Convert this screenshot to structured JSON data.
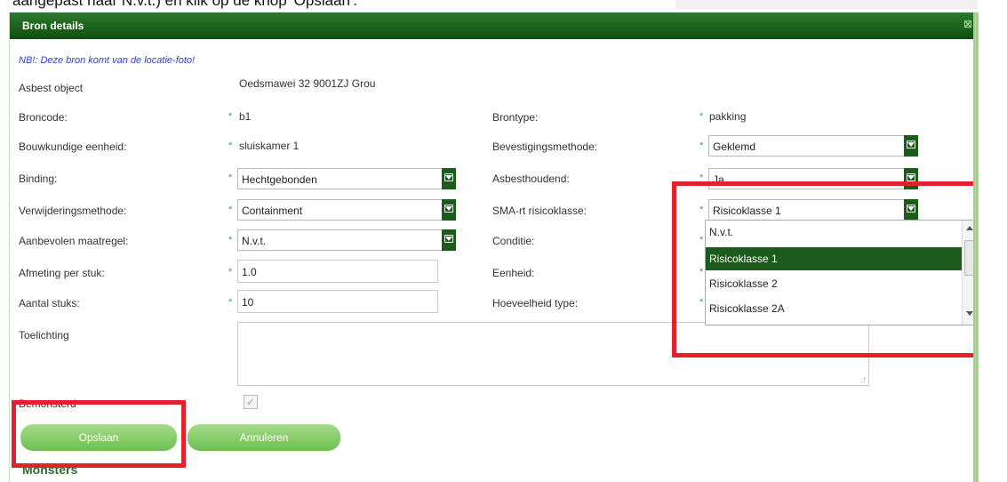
{
  "doc_caption": "aangepast naar N.v.t.) en klik op de knop 'Opslaan'.",
  "dialog": {
    "title": "Bron details",
    "note": "NB!: Deze bron komt van de locatie-foto!"
  },
  "fields": {
    "asbest_object": {
      "label": "Asbest object",
      "value": "Oedsmawei 32 9001ZJ Grou"
    },
    "broncode": {
      "label": "Broncode:",
      "value": "b1"
    },
    "brontype": {
      "label": "Brontype:",
      "value": "pakking"
    },
    "bouwkundige_eenheid": {
      "label": "Bouwkundige eenheid:",
      "value": "sluiskamer 1"
    },
    "bevestigingsmethode": {
      "label": "Bevestigingsmethode:",
      "value": "Geklemd"
    },
    "binding": {
      "label": "Binding:",
      "value": "Hechtgebonden"
    },
    "asbesthoudend": {
      "label": "Asbesthoudend:",
      "value": "Ja"
    },
    "verwijderingsmethode": {
      "label": "Verwijderingsmethode:",
      "value": "Containment"
    },
    "sma_rt": {
      "label": "SMA-rt risicoklasse:",
      "value": "Risicoklasse 1"
    },
    "aanbevolen_maatregel": {
      "label": "Aanbevolen maatregel:",
      "value": "N.v.t."
    },
    "conditie": {
      "label": "Conditie:"
    },
    "afmeting_per_stuk": {
      "label": "Afmeting per stuk:",
      "value": "1.0"
    },
    "eenheid": {
      "label": "Eenheid:"
    },
    "aantal_stuks": {
      "label": "Aantal stuks:",
      "value": "10"
    },
    "hoeveelheid_type": {
      "label": "Hoeveelheid type:"
    },
    "toelichting": {
      "label": "Toelichting"
    },
    "bemonsterd": {
      "label": "Bemonsterd"
    }
  },
  "required_marker": "*",
  "dropdown": {
    "options": [
      "N.v.t.",
      "Risicoklasse 1",
      "Risicoklasse 2",
      "Risicoklasse 2A"
    ],
    "selected": "Risicoklasse 1"
  },
  "buttons": {
    "save": "Opslaan",
    "cancel": "Annuleren"
  },
  "section_next": "Monsters",
  "colors": {
    "header": "#1a5e1a",
    "accent_green": "#6cbf4f",
    "highlight_red": "#e4202c",
    "note_blue": "#2a3fd1"
  }
}
